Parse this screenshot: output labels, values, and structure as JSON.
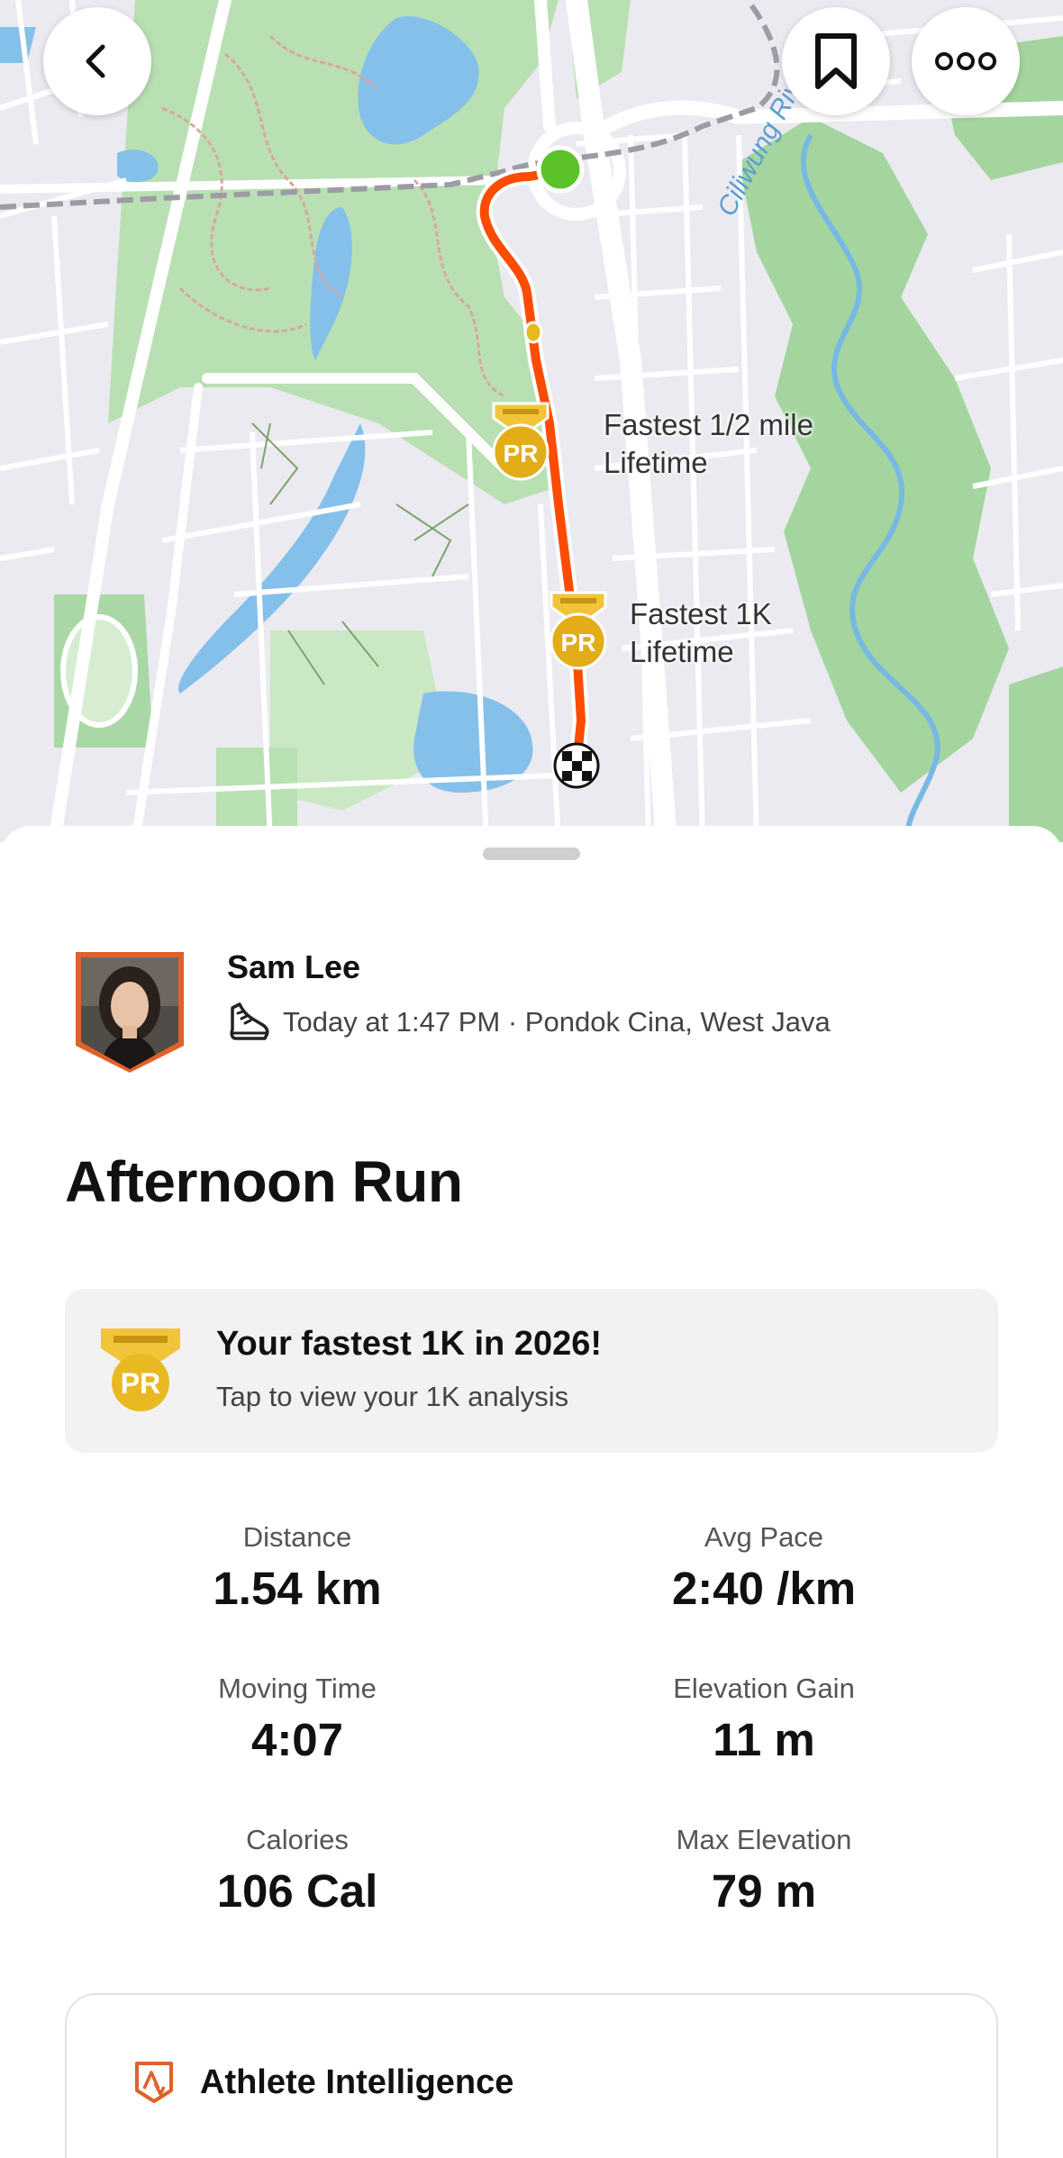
{
  "map": {
    "river_label": "Ciliwung River",
    "pr_markers": [
      {
        "line1": "Fastest 1/2 mile",
        "line2": "Lifetime",
        "badge": "PR"
      },
      {
        "line1": "Fastest 1K",
        "line2": "Lifetime",
        "badge": "PR"
      }
    ],
    "route_color": "#fc4c02",
    "start_color": "#5cc22a",
    "pr_color": "#e8b923"
  },
  "header_buttons": {
    "back_icon": "chevron-left-icon",
    "bookmark_icon": "bookmark-icon",
    "more_icon": "more-icon"
  },
  "activity": {
    "athlete_name": "Sam Lee",
    "meta": "Today at 1:47 PM · Pondok Cina, West Java",
    "sport_icon": "running-shoe-icon",
    "title": "Afternoon Run"
  },
  "pr_card": {
    "title": "Your fastest 1K in 2026!",
    "subtitle": "Tap to view your 1K analysis",
    "badge": "PR"
  },
  "stats": [
    {
      "label": "Distance",
      "value": "1.54 km"
    },
    {
      "label": "Avg Pace",
      "value": "2:40 /km"
    },
    {
      "label": "Moving Time",
      "value": "4:07"
    },
    {
      "label": "Elevation Gain",
      "value": "11 m"
    },
    {
      "label": "Calories",
      "value": "106 Cal"
    },
    {
      "label": "Max Elevation",
      "value": "79 m"
    }
  ],
  "athlete_intelligence": {
    "title": "Athlete Intelligence",
    "icon": "strava-intelligence-icon"
  }
}
